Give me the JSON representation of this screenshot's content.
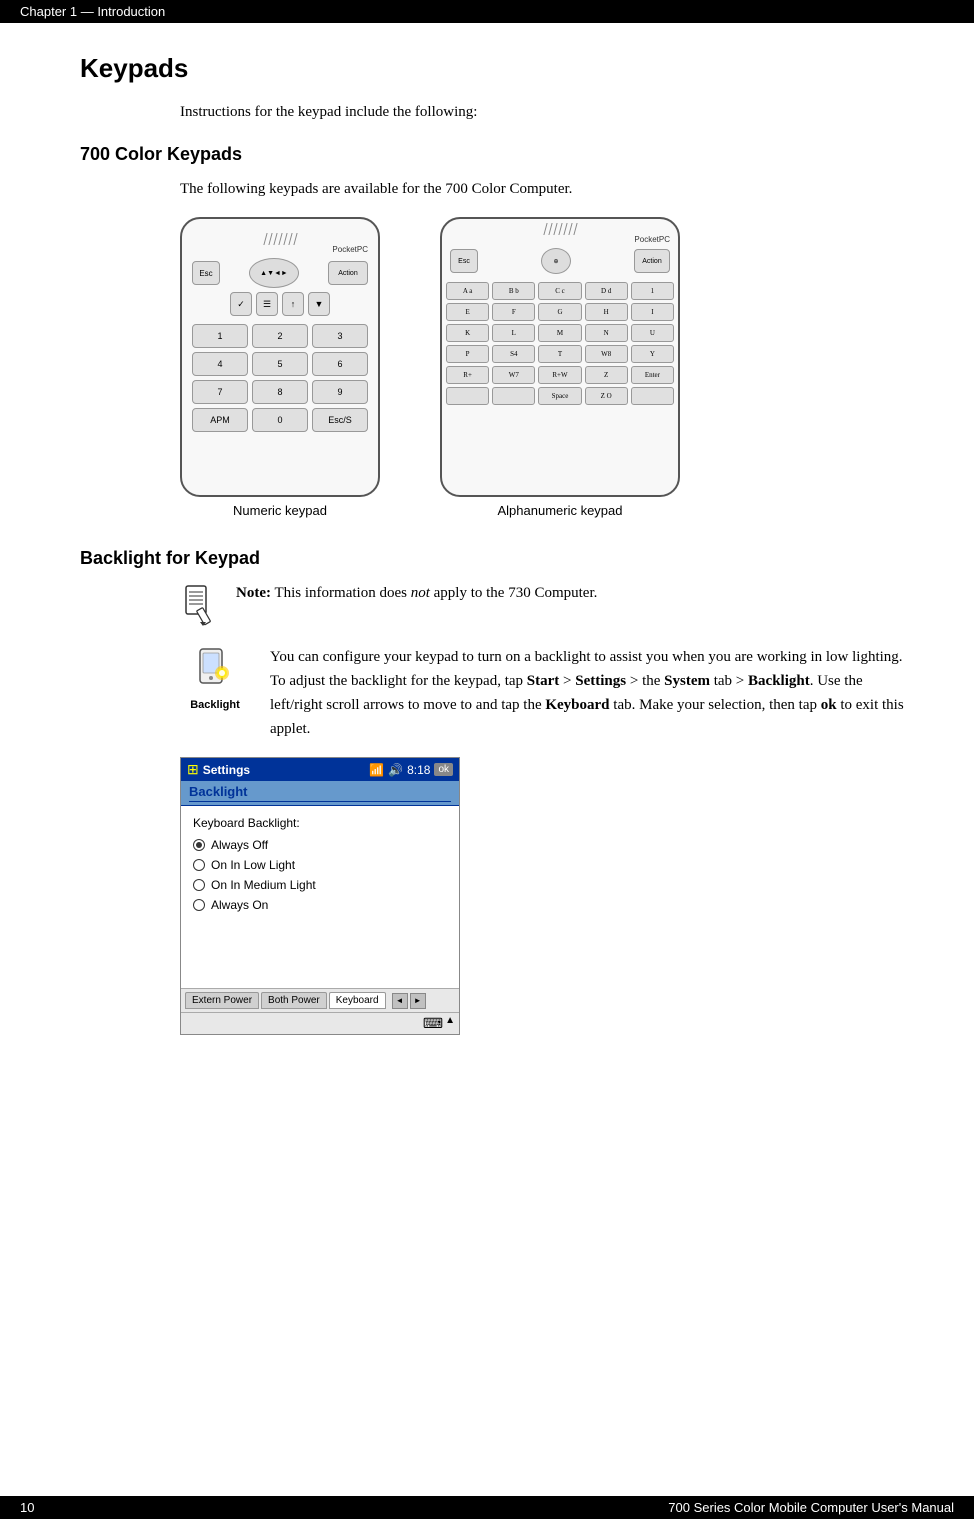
{
  "top_bar": {
    "left": "Chapter 1  —  Introduction",
    "chapter_label": "Chapter 1",
    "dash": "—",
    "intro_label": "Introduction"
  },
  "bottom_bar": {
    "left": "10",
    "right": "700 Series Color Mobile Computer User's Manual"
  },
  "page": {
    "section_title": "Keypads",
    "intro_text": "Instructions for the keypad include the following:",
    "subsection_700": "700 Color Keypads",
    "subsection_700_text": "The following keypads are available for the 700 Color Computer.",
    "numeric_label": "Numeric keypad",
    "alphanumeric_label": "Alphanumeric keypad",
    "subsection_backlight": "Backlight for Keypad",
    "note_label": "Note:",
    "note_text": "This information does not apply to the 730 Computer.",
    "note_italic": "not",
    "backlight_icon_label": "Backlight",
    "backlight_text_1": "You can configure your keypad to turn on a backlight to assist you when you are working in low lighting. To adjust the backlight for the keypad, tap ",
    "backlight_start": "Start",
    "backlight_settings": "Settings",
    "backlight_system": "System",
    "backlight_tab": "tab",
    "backlight_backlight": "Backlight",
    "backlight_text_2": ". Use the left/right scroll arrows to move to and tap the ",
    "backlight_keyboard": "Keyboard",
    "backlight_tab2": "tab",
    "backlight_text_3": ". Make your selection, then tap ",
    "backlight_ok": "ok",
    "backlight_text_4": " to exit this applet.",
    "settings_title": "Settings",
    "settings_time": "8:18",
    "settings_header": "Backlight",
    "settings_section": "Keyboard Backlight:",
    "radio_options": [
      {
        "label": "Always Off",
        "selected": true
      },
      {
        "label": "On In Low Light",
        "selected": false
      },
      {
        "label": "On In Medium Light",
        "selected": false
      },
      {
        "label": "Always On",
        "selected": false
      }
    ],
    "tab_extern": "Extern Power",
    "tab_both": "Both Power",
    "tab_keyboard": "Keyboard"
  },
  "keypad": {
    "brand": "PocketPC",
    "numeric_keys": [
      "1",
      "2",
      "3",
      "4",
      "5",
      "6",
      "7",
      "8",
      "9",
      "APM",
      "0",
      "Esc S"
    ],
    "alpha_keys": [
      "A a1",
      "B b1",
      "C c1",
      "D d1",
      "1 S",
      "E mn",
      "F +",
      "G g",
      "H",
      "I S",
      "K @",
      "L -",
      "M1",
      "N 2",
      "U G",
      "P",
      "S 4",
      "T 5",
      "W 8",
      "Y",
      "R+",
      "W 7",
      "R+W",
      "Z O",
      "Enter",
      "",
      "",
      "Space",
      "Z O",
      ""
    ]
  }
}
